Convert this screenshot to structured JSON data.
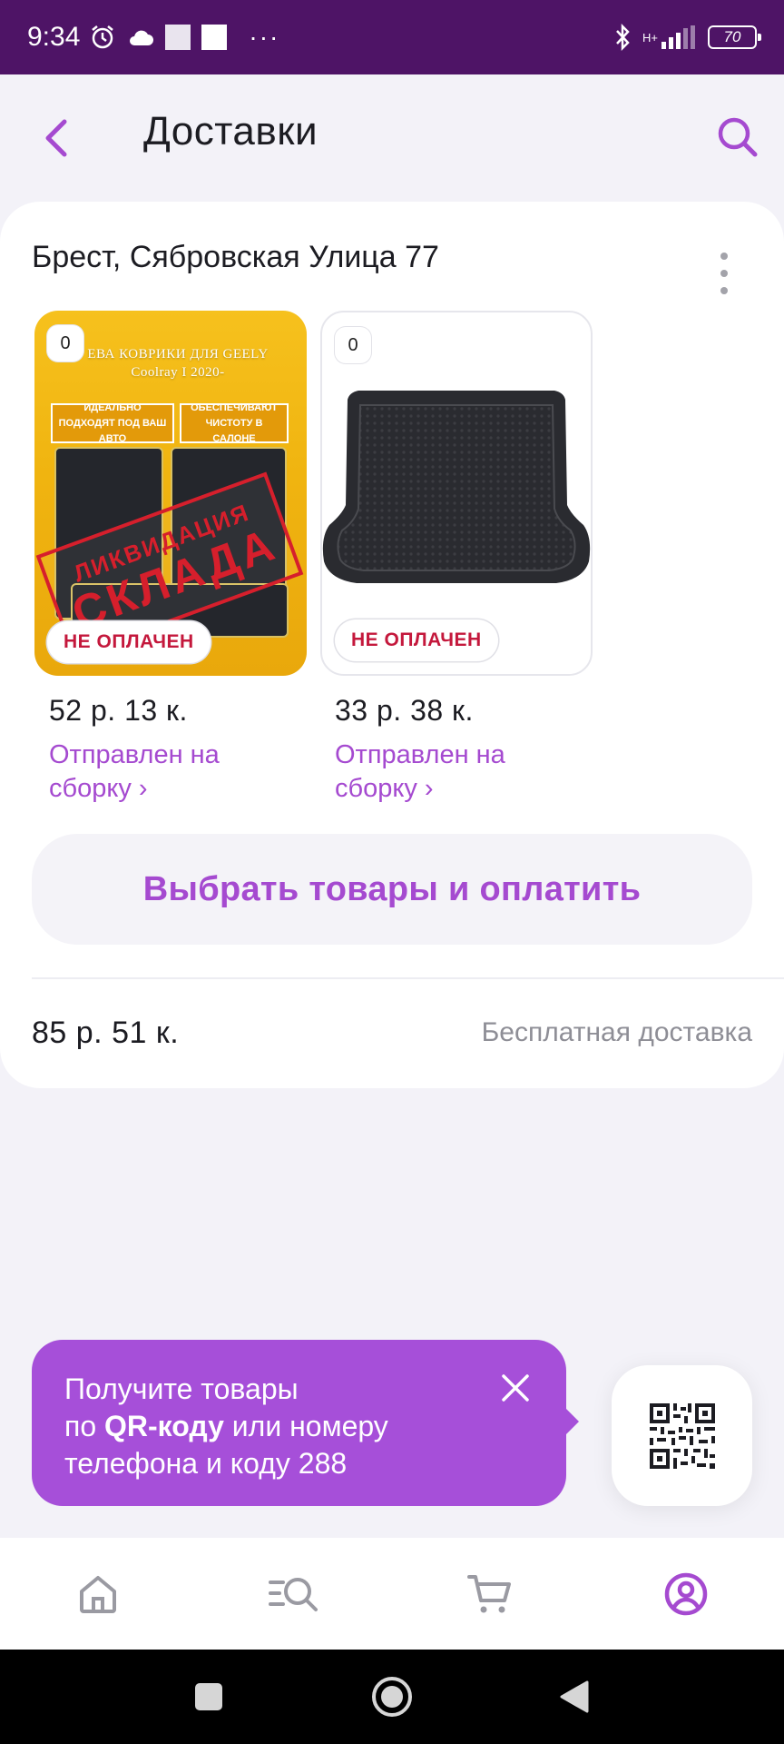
{
  "status_bar": {
    "time": "9:34",
    "network": "H+",
    "battery": "70"
  },
  "header": {
    "title": "Доставки"
  },
  "delivery": {
    "address": "Брест, Сябровская Улица 77",
    "items": [
      {
        "quantity": "0",
        "payment_status": "НЕ ОПЛАЧЕН",
        "price": "52 р. 13 к.",
        "order_status": "Отправлен на сборку ›",
        "image": {
          "title": "ЕВА КОВРИКИ ДЛЯ GEELY Coolray I 2020-",
          "tag_left": "ИДЕАЛЬНО ПОДХОДЯТ ПОД ВАШ АВТО",
          "tag_right": "ОБЕСПЕЧИВАЮТ ЧИСТОТУ В САЛОНЕ",
          "stamp_line1": "ЛИКВИДАЦИЯ",
          "stamp_line2": "СКЛАДА"
        }
      },
      {
        "quantity": "0",
        "payment_status": "НЕ ОПЛАЧЕН",
        "price": "33 р. 38 к.",
        "order_status": "Отправлен на сборку ›"
      }
    ],
    "select_pay_button": "Выбрать товары и оплатить",
    "total": "85 р. 51 к.",
    "delivery_type": "Бесплатная доставка"
  },
  "qr_tooltip": {
    "text_line1": "Получите товары",
    "text_prefix": "по ",
    "text_bold": "QR-коду",
    "text_suffix": " или номеру",
    "text_line3": "телефона и коду 288"
  },
  "bottom_nav": {
    "items": [
      "home-icon",
      "catalog-search-icon",
      "cart-icon",
      "profile-icon"
    ],
    "active": "profile-icon"
  },
  "colors": {
    "accent": "#a54ad0",
    "status_bar": "#4e1466",
    "unpaid": "#c4183c",
    "tooltip": "#a64fd9"
  }
}
